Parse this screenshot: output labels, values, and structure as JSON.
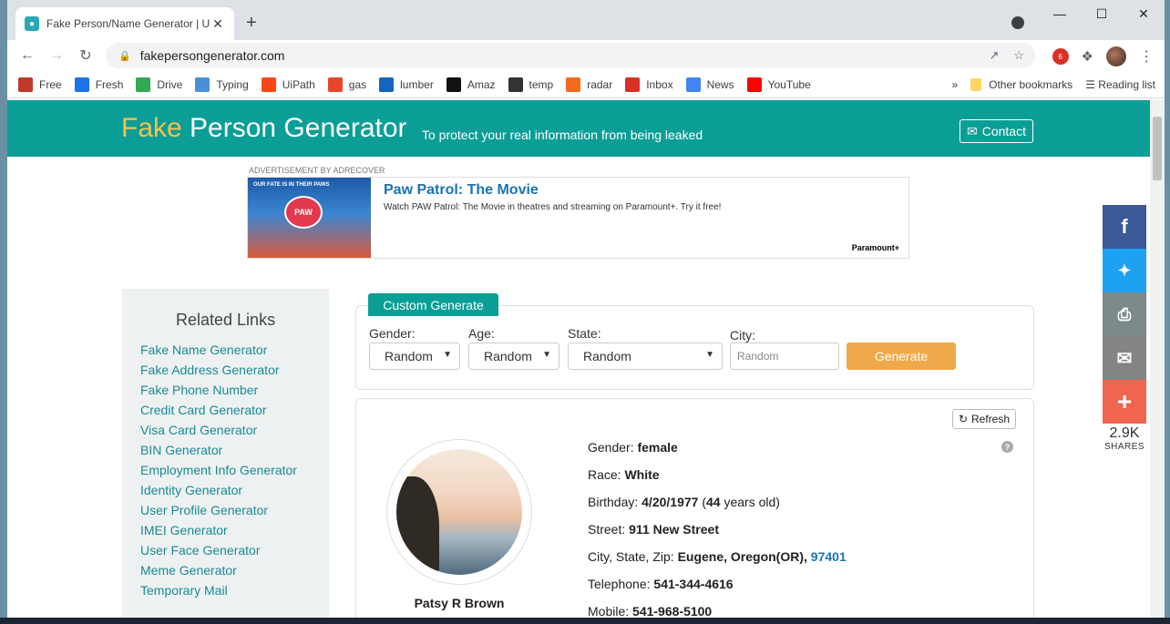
{
  "browser": {
    "tab_title": "Fake Person/Name Generator | U",
    "url": "fakepersongenerator.com",
    "extension_badge": "6",
    "bookmarks": [
      {
        "label": "Free",
        "icon": "free-icon",
        "color": "#c0392b"
      },
      {
        "label": "Fresh",
        "icon": "fresh-icon",
        "color": "#1a73e8"
      },
      {
        "label": "Drive",
        "icon": "drive-icon",
        "color": "#34a853"
      },
      {
        "label": "Typing",
        "icon": "typing-icon",
        "color": "#4a90d9"
      },
      {
        "label": "UiPath",
        "icon": "uipath-icon",
        "color": "#fa4616"
      },
      {
        "label": "gas",
        "icon": "gas-icon",
        "color": "#e8452c"
      },
      {
        "label": "lumber",
        "icon": "lumber-icon",
        "color": "#1565c0"
      },
      {
        "label": "Amaz",
        "icon": "amazon-icon",
        "color": "#111111"
      },
      {
        "label": "temp",
        "icon": "temp-icon",
        "color": "#333333"
      },
      {
        "label": "radar",
        "icon": "radar-icon",
        "color": "#f26b1d"
      },
      {
        "label": "Inbox",
        "icon": "gmail-icon",
        "color": "#d93025"
      },
      {
        "label": "News",
        "icon": "news-icon",
        "color": "#4285f4"
      },
      {
        "label": "YouTube",
        "icon": "youtube-icon",
        "color": "#ff0000"
      }
    ],
    "other_bookmarks": "Other bookmarks",
    "reading_list": "Reading list"
  },
  "site": {
    "logo_fake": "Fake",
    "logo_rest": "Person Generator",
    "tagline": "To protect your real information from being leaked",
    "contact": "Contact",
    "brand_color": "#0b9e96"
  },
  "ad": {
    "label": "ADVERTISEMENT BY ADRECOVER",
    "image_caption": "OUR FATE IS IN THEIR PAWS",
    "image_badge": "PAW",
    "title": "Paw Patrol: The Movie",
    "text": "Watch PAW Patrol: The Movie in theatres and streaming on Paramount+. Try it free!",
    "brand": "Paramount+"
  },
  "sidebar": {
    "title": "Related Links",
    "links": [
      "Fake Name Generator",
      "Fake Address Generator",
      "Fake Phone Number",
      "Credit Card Generator",
      "Visa Card Generator",
      "BIN Generator",
      "Employment Info Generator",
      "Identity Generator",
      "User Profile Generator",
      "IMEI Generator",
      "User Face Generator",
      "Meme Generator",
      "Temporary Mail"
    ]
  },
  "custom": {
    "tab_label": "Custom Generate",
    "gender_label": "Gender:",
    "gender_value": "Random",
    "age_label": "Age:",
    "age_value": "Random",
    "state_label": "State:",
    "state_value": "Random",
    "city_label": "City:",
    "city_placeholder": "Random",
    "generate": "Generate"
  },
  "person": {
    "refresh": "Refresh",
    "name": "Patsy R Brown",
    "gender_label": "Gender:",
    "gender": "female",
    "race_label": "Race:",
    "race": "White",
    "birthday_label": "Birthday:",
    "birthday": "4/20/1977",
    "age_open": "(",
    "age": "44",
    "age_suffix": "years old)",
    "street_label": "Street:",
    "street": "911 New Street",
    "city_label": "City, State, Zip:",
    "city_state": "Eugene, Oregon(OR),",
    "zip": "97401",
    "telephone_label": "Telephone:",
    "telephone": "541-344-4616",
    "mobile_label": "Mobile:",
    "mobile": "541-968-5100"
  },
  "share": {
    "count": "2.9K",
    "label": "SHARES",
    "colors": {
      "facebook": "#3b5998",
      "twitter": "#1da1f2",
      "print": "#7d8a8c",
      "email": "#848484",
      "more": "#f0654f"
    }
  }
}
